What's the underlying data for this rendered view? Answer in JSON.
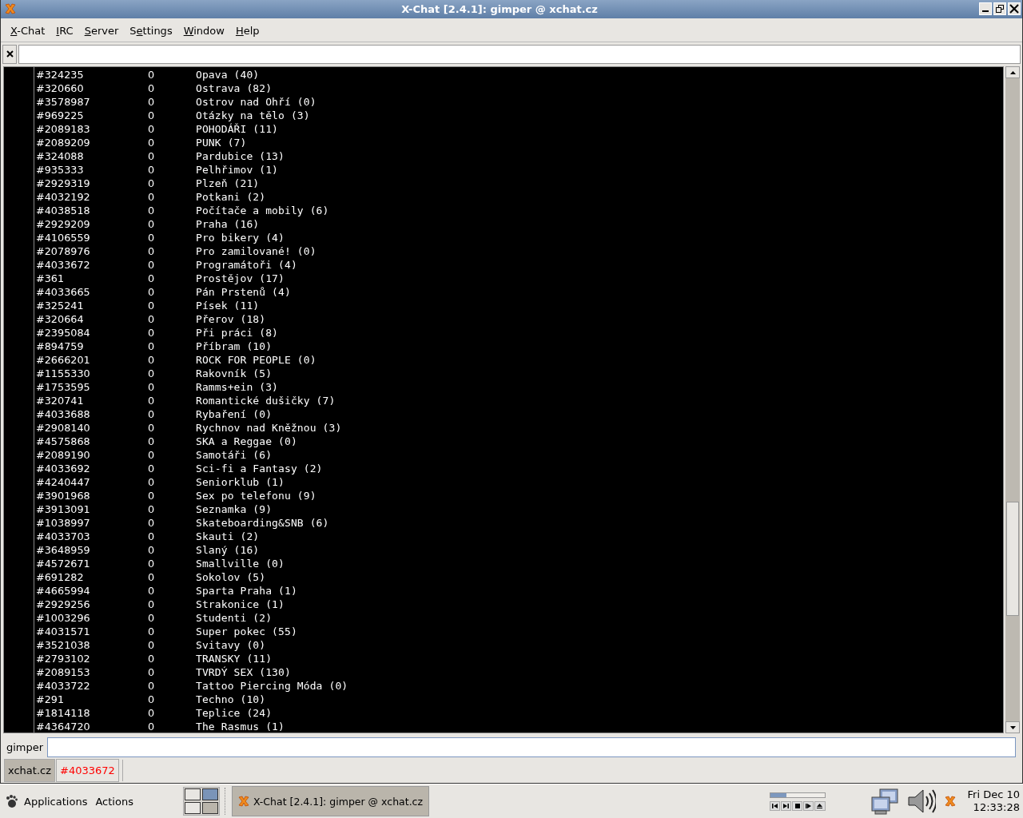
{
  "window": {
    "title": "X-Chat [2.4.1]: gimper @ xchat.cz"
  },
  "menubar": [
    {
      "key": "X",
      "post": "-Chat"
    },
    {
      "key": "I",
      "post": "RC"
    },
    {
      "key": "S",
      "post": "erver"
    },
    {
      "pre": "S",
      "key": "e",
      "post": "ttings"
    },
    {
      "key": "W",
      "post": "indow"
    },
    {
      "key": "H",
      "post": "elp"
    }
  ],
  "channel_list": [
    {
      "channel": "#324235",
      "users": "0",
      "topic": "Opava (40)"
    },
    {
      "channel": "#320660",
      "users": "0",
      "topic": "Ostrava (82)"
    },
    {
      "channel": "#3578987",
      "users": "0",
      "topic": "Ostrov nad Ohří (0)"
    },
    {
      "channel": "#969225",
      "users": "0",
      "topic": "Otázky na tělo (3)"
    },
    {
      "channel": "#2089183",
      "users": "0",
      "topic": "POHODÁŘI (11)"
    },
    {
      "channel": "#2089209",
      "users": "0",
      "topic": "PUNK (7)"
    },
    {
      "channel": "#324088",
      "users": "0",
      "topic": "Pardubice (13)"
    },
    {
      "channel": "#935333",
      "users": "0",
      "topic": "Pelhřimov (1)"
    },
    {
      "channel": "#2929319",
      "users": "0",
      "topic": "Plzeň (21)"
    },
    {
      "channel": "#4032192",
      "users": "0",
      "topic": "Potkani (2)"
    },
    {
      "channel": "#4038518",
      "users": "0",
      "topic": "Počítače a mobily (6)"
    },
    {
      "channel": "#2929209",
      "users": "0",
      "topic": "Praha (16)"
    },
    {
      "channel": "#4106559",
      "users": "0",
      "topic": "Pro bikery (4)"
    },
    {
      "channel": "#2078976",
      "users": "0",
      "topic": "Pro zamilované! (0)"
    },
    {
      "channel": "#4033672",
      "users": "0",
      "topic": "Programátoři (4)"
    },
    {
      "channel": "#361",
      "users": "0",
      "topic": "Prostějov (17)"
    },
    {
      "channel": "#4033665",
      "users": "0",
      "topic": "Pán Prstenů (4)"
    },
    {
      "channel": "#325241",
      "users": "0",
      "topic": "Písek (11)"
    },
    {
      "channel": "#320664",
      "users": "0",
      "topic": "Přerov (18)"
    },
    {
      "channel": "#2395084",
      "users": "0",
      "topic": "Při práci (8)"
    },
    {
      "channel": "#894759",
      "users": "0",
      "topic": "Příbram (10)"
    },
    {
      "channel": "#2666201",
      "users": "0",
      "topic": "ROCK FOR PEOPLE (0)"
    },
    {
      "channel": "#1155330",
      "users": "0",
      "topic": "Rakovník (5)"
    },
    {
      "channel": "#1753595",
      "users": "0",
      "topic": "Ramms+ein (3)"
    },
    {
      "channel": "#320741",
      "users": "0",
      "topic": "Romantické dušičky (7)"
    },
    {
      "channel": "#4033688",
      "users": "0",
      "topic": "Rybaření (0)"
    },
    {
      "channel": "#2908140",
      "users": "0",
      "topic": "Rychnov nad Kněžnou (3)"
    },
    {
      "channel": "#4575868",
      "users": "0",
      "topic": "SKA a Reggae (0)"
    },
    {
      "channel": "#2089190",
      "users": "0",
      "topic": "Samotáři (6)"
    },
    {
      "channel": "#4033692",
      "users": "0",
      "topic": "Sci-fi a Fantasy (2)"
    },
    {
      "channel": "#4240447",
      "users": "0",
      "topic": "Seniorklub (1)"
    },
    {
      "channel": "#3901968",
      "users": "0",
      "topic": "Sex po telefonu (9)"
    },
    {
      "channel": "#3913091",
      "users": "0",
      "topic": "Seznamka (9)"
    },
    {
      "channel": "#1038997",
      "users": "0",
      "topic": "Skateboarding&SNB (6)"
    },
    {
      "channel": "#4033703",
      "users": "0",
      "topic": "Skauti (2)"
    },
    {
      "channel": "#3648959",
      "users": "0",
      "topic": "Slaný (16)"
    },
    {
      "channel": "#4572671",
      "users": "0",
      "topic": "Smallville (0)"
    },
    {
      "channel": "#691282",
      "users": "0",
      "topic": "Sokolov (5)"
    },
    {
      "channel": "#4665994",
      "users": "0",
      "topic": "Sparta Praha (1)"
    },
    {
      "channel": "#2929256",
      "users": "0",
      "topic": "Strakonice (1)"
    },
    {
      "channel": "#1003296",
      "users": "0",
      "topic": "Studenti (2)"
    },
    {
      "channel": "#4031571",
      "users": "0",
      "topic": "Super pokec (55)"
    },
    {
      "channel": "#3521038",
      "users": "0",
      "topic": "Svitavy (0)"
    },
    {
      "channel": "#2793102",
      "users": "0",
      "topic": "TRANSKY (11)"
    },
    {
      "channel": "#2089153",
      "users": "0",
      "topic": "TVRDÝ SEX (130)"
    },
    {
      "channel": "#4033722",
      "users": "0",
      "topic": "Tattoo Piercing Móda (0)"
    },
    {
      "channel": "#291",
      "users": "0",
      "topic": "Techno (10)"
    },
    {
      "channel": "#1814118",
      "users": "0",
      "topic": "Teplice (24)"
    },
    {
      "channel": "#4364720",
      "users": "0",
      "topic": "The Rasmus (1)"
    }
  ],
  "input": {
    "nick": "gimper"
  },
  "tabs": [
    {
      "label": "xchat.cz",
      "selected": true,
      "color": "#000000"
    },
    {
      "label": "#4033672",
      "selected": false,
      "color": "#ff0000"
    }
  ],
  "taskbar": {
    "menus": [
      "Applications",
      "Actions"
    ],
    "task": {
      "label": "X-Chat [2.4.1]: gimper @ xchat.cz",
      "selected": true
    },
    "player": {
      "level": 0.3
    },
    "clock": {
      "date": "Fri Dec 10",
      "time": "12:33:28"
    }
  }
}
